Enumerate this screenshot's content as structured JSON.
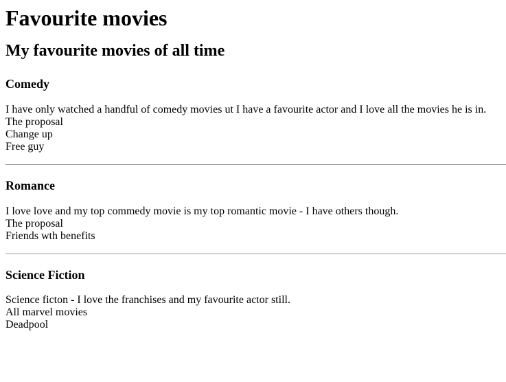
{
  "page": {
    "title": "Favourite movies",
    "subtitle": "My favourite movies of all time"
  },
  "sections": [
    {
      "heading": "Comedy",
      "description": "I have only watched a handful of comedy movies ut I have a favourite actor and I love all the movies he is in.",
      "movies": [
        "The proposal",
        "Change up",
        "Free guy"
      ]
    },
    {
      "heading": "Romance",
      "description": "I love love and my top commedy movie is my top romantic movie - I have others though.",
      "movies": [
        "The proposal",
        "Friends wth benefits"
      ]
    },
    {
      "heading": "Science Fiction",
      "description": "Science ficton - I love the franchises and my favourite actor still.",
      "movies": [
        "All marvel movies",
        "Deadpool"
      ]
    }
  ]
}
